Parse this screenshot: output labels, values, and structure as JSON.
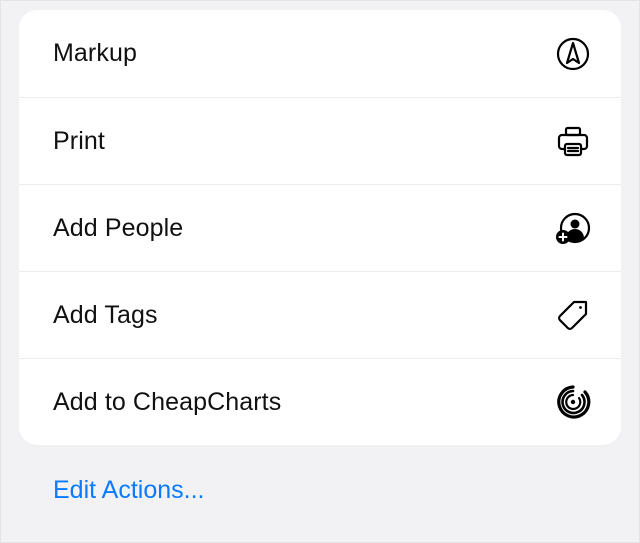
{
  "actions": [
    {
      "id": "markup",
      "label": "Markup",
      "icon": "markup-icon"
    },
    {
      "id": "print",
      "label": "Print",
      "icon": "print-icon"
    },
    {
      "id": "add-people",
      "label": "Add People",
      "icon": "add-people-icon"
    },
    {
      "id": "add-tags",
      "label": "Add Tags",
      "icon": "tag-icon"
    },
    {
      "id": "add-cheapcharts",
      "label": "Add to CheapCharts",
      "icon": "cheapcharts-icon"
    }
  ],
  "edit_actions_label": "Edit Actions..."
}
